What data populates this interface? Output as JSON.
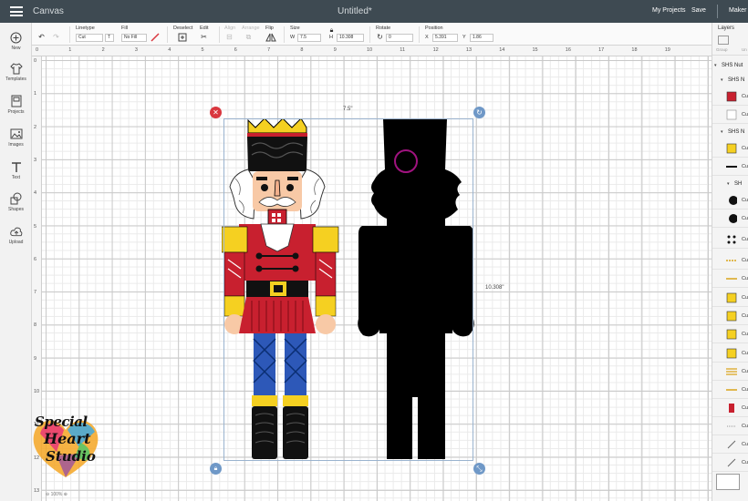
{
  "app": {
    "title": "Canvas",
    "document_title": "Untitled*",
    "links": [
      "My Projects",
      "Save",
      "Maker"
    ]
  },
  "toolbar": {
    "linetype": {
      "label": "Linetype",
      "value": "Cut"
    },
    "fill": {
      "label": "Fill",
      "value": "No Fill"
    },
    "deselect": {
      "label": "Deselect"
    },
    "edit": {
      "label": "Edit"
    },
    "align": {
      "label": "Align"
    },
    "arrange": {
      "label": "Arrange"
    },
    "flip": {
      "label": "Flip"
    },
    "size": {
      "label": "Size",
      "w_label": "W",
      "w": "7.5",
      "h_label": "H",
      "h": "10.308"
    },
    "rotate": {
      "label": "Rotate",
      "value": "0"
    },
    "position": {
      "label": "Position",
      "x_label": "X",
      "x": "5.391",
      "y_label": "Y",
      "y": "1.86"
    }
  },
  "left_rail": [
    {
      "label": "New",
      "icon": "plus-icon"
    },
    {
      "label": "Templates",
      "icon": "shirt-icon"
    },
    {
      "label": "Projects",
      "icon": "projects-icon"
    },
    {
      "label": "Images",
      "icon": "image-icon"
    },
    {
      "label": "Text",
      "icon": "text-icon"
    },
    {
      "label": "Shapes",
      "icon": "shapes-icon"
    },
    {
      "label": "Upload",
      "icon": "cloud-upload-icon"
    }
  ],
  "rulers": {
    "top": [
      "0",
      "1",
      "2",
      "3",
      "4",
      "5",
      "6",
      "7",
      "8",
      "9",
      "10",
      "11",
      "12",
      "13",
      "14",
      "15",
      "16",
      "17",
      "18",
      "19"
    ],
    "left": [
      "0",
      "1",
      "2",
      "3",
      "4",
      "5",
      "6",
      "7",
      "8",
      "9",
      "10",
      "11",
      "12",
      "13"
    ]
  },
  "selection": {
    "width_label": "7.5\"",
    "height_label": "10.308\""
  },
  "zoom": {
    "value": "100%"
  },
  "layers": {
    "title": "Layers",
    "tools": [
      "Group",
      "Un"
    ],
    "groups": [
      "SHS Nut",
      "SHS N",
      "SHS N",
      "SH"
    ],
    "item_label": "Cu"
  },
  "colors": {
    "topbar": "#3e4a52",
    "accent_red": "#d9363e",
    "handle_blue": "#6f98c7",
    "nutcracker_red": "#c8202f",
    "nutcracker_yellow": "#f5d021",
    "nutcracker_blue": "#2d58b8",
    "silhouette": "#000000"
  },
  "logo": {
    "line1": "Special",
    "line2": "Heart",
    "line3": "Studio"
  }
}
